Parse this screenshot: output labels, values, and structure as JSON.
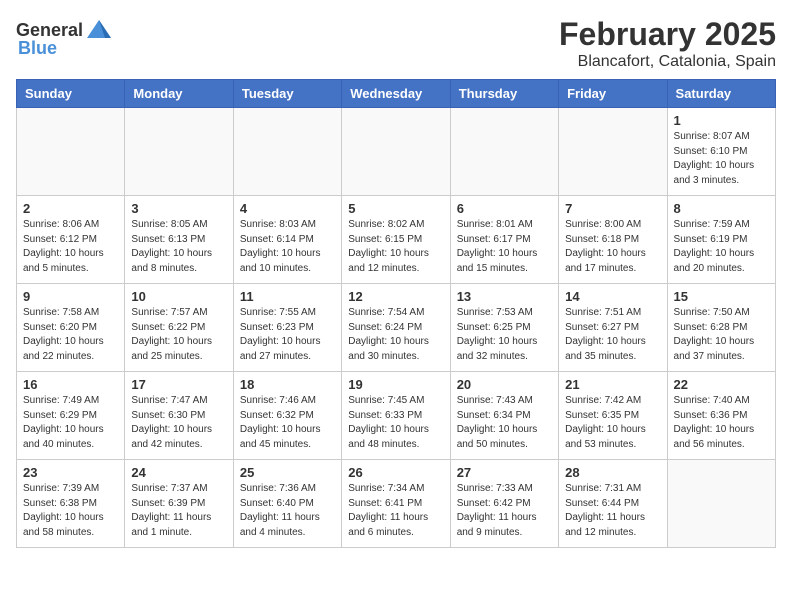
{
  "header": {
    "logo_general": "General",
    "logo_blue": "Blue",
    "month": "February 2025",
    "location": "Blancafort, Catalonia, Spain"
  },
  "weekdays": [
    "Sunday",
    "Monday",
    "Tuesday",
    "Wednesday",
    "Thursday",
    "Friday",
    "Saturday"
  ],
  "weeks": [
    [
      {
        "day": "",
        "info": ""
      },
      {
        "day": "",
        "info": ""
      },
      {
        "day": "",
        "info": ""
      },
      {
        "day": "",
        "info": ""
      },
      {
        "day": "",
        "info": ""
      },
      {
        "day": "",
        "info": ""
      },
      {
        "day": "1",
        "info": "Sunrise: 8:07 AM\nSunset: 6:10 PM\nDaylight: 10 hours and 3 minutes."
      }
    ],
    [
      {
        "day": "2",
        "info": "Sunrise: 8:06 AM\nSunset: 6:12 PM\nDaylight: 10 hours and 5 minutes."
      },
      {
        "day": "3",
        "info": "Sunrise: 8:05 AM\nSunset: 6:13 PM\nDaylight: 10 hours and 8 minutes."
      },
      {
        "day": "4",
        "info": "Sunrise: 8:03 AM\nSunset: 6:14 PM\nDaylight: 10 hours and 10 minutes."
      },
      {
        "day": "5",
        "info": "Sunrise: 8:02 AM\nSunset: 6:15 PM\nDaylight: 10 hours and 12 minutes."
      },
      {
        "day": "6",
        "info": "Sunrise: 8:01 AM\nSunset: 6:17 PM\nDaylight: 10 hours and 15 minutes."
      },
      {
        "day": "7",
        "info": "Sunrise: 8:00 AM\nSunset: 6:18 PM\nDaylight: 10 hours and 17 minutes."
      },
      {
        "day": "8",
        "info": "Sunrise: 7:59 AM\nSunset: 6:19 PM\nDaylight: 10 hours and 20 minutes."
      }
    ],
    [
      {
        "day": "9",
        "info": "Sunrise: 7:58 AM\nSunset: 6:20 PM\nDaylight: 10 hours and 22 minutes."
      },
      {
        "day": "10",
        "info": "Sunrise: 7:57 AM\nSunset: 6:22 PM\nDaylight: 10 hours and 25 minutes."
      },
      {
        "day": "11",
        "info": "Sunrise: 7:55 AM\nSunset: 6:23 PM\nDaylight: 10 hours and 27 minutes."
      },
      {
        "day": "12",
        "info": "Sunrise: 7:54 AM\nSunset: 6:24 PM\nDaylight: 10 hours and 30 minutes."
      },
      {
        "day": "13",
        "info": "Sunrise: 7:53 AM\nSunset: 6:25 PM\nDaylight: 10 hours and 32 minutes."
      },
      {
        "day": "14",
        "info": "Sunrise: 7:51 AM\nSunset: 6:27 PM\nDaylight: 10 hours and 35 minutes."
      },
      {
        "day": "15",
        "info": "Sunrise: 7:50 AM\nSunset: 6:28 PM\nDaylight: 10 hours and 37 minutes."
      }
    ],
    [
      {
        "day": "16",
        "info": "Sunrise: 7:49 AM\nSunset: 6:29 PM\nDaylight: 10 hours and 40 minutes."
      },
      {
        "day": "17",
        "info": "Sunrise: 7:47 AM\nSunset: 6:30 PM\nDaylight: 10 hours and 42 minutes."
      },
      {
        "day": "18",
        "info": "Sunrise: 7:46 AM\nSunset: 6:32 PM\nDaylight: 10 hours and 45 minutes."
      },
      {
        "day": "19",
        "info": "Sunrise: 7:45 AM\nSunset: 6:33 PM\nDaylight: 10 hours and 48 minutes."
      },
      {
        "day": "20",
        "info": "Sunrise: 7:43 AM\nSunset: 6:34 PM\nDaylight: 10 hours and 50 minutes."
      },
      {
        "day": "21",
        "info": "Sunrise: 7:42 AM\nSunset: 6:35 PM\nDaylight: 10 hours and 53 minutes."
      },
      {
        "day": "22",
        "info": "Sunrise: 7:40 AM\nSunset: 6:36 PM\nDaylight: 10 hours and 56 minutes."
      }
    ],
    [
      {
        "day": "23",
        "info": "Sunrise: 7:39 AM\nSunset: 6:38 PM\nDaylight: 10 hours and 58 minutes."
      },
      {
        "day": "24",
        "info": "Sunrise: 7:37 AM\nSunset: 6:39 PM\nDaylight: 11 hours and 1 minute."
      },
      {
        "day": "25",
        "info": "Sunrise: 7:36 AM\nSunset: 6:40 PM\nDaylight: 11 hours and 4 minutes."
      },
      {
        "day": "26",
        "info": "Sunrise: 7:34 AM\nSunset: 6:41 PM\nDaylight: 11 hours and 6 minutes."
      },
      {
        "day": "27",
        "info": "Sunrise: 7:33 AM\nSunset: 6:42 PM\nDaylight: 11 hours and 9 minutes."
      },
      {
        "day": "28",
        "info": "Sunrise: 7:31 AM\nSunset: 6:44 PM\nDaylight: 11 hours and 12 minutes."
      },
      {
        "day": "",
        "info": ""
      }
    ]
  ]
}
